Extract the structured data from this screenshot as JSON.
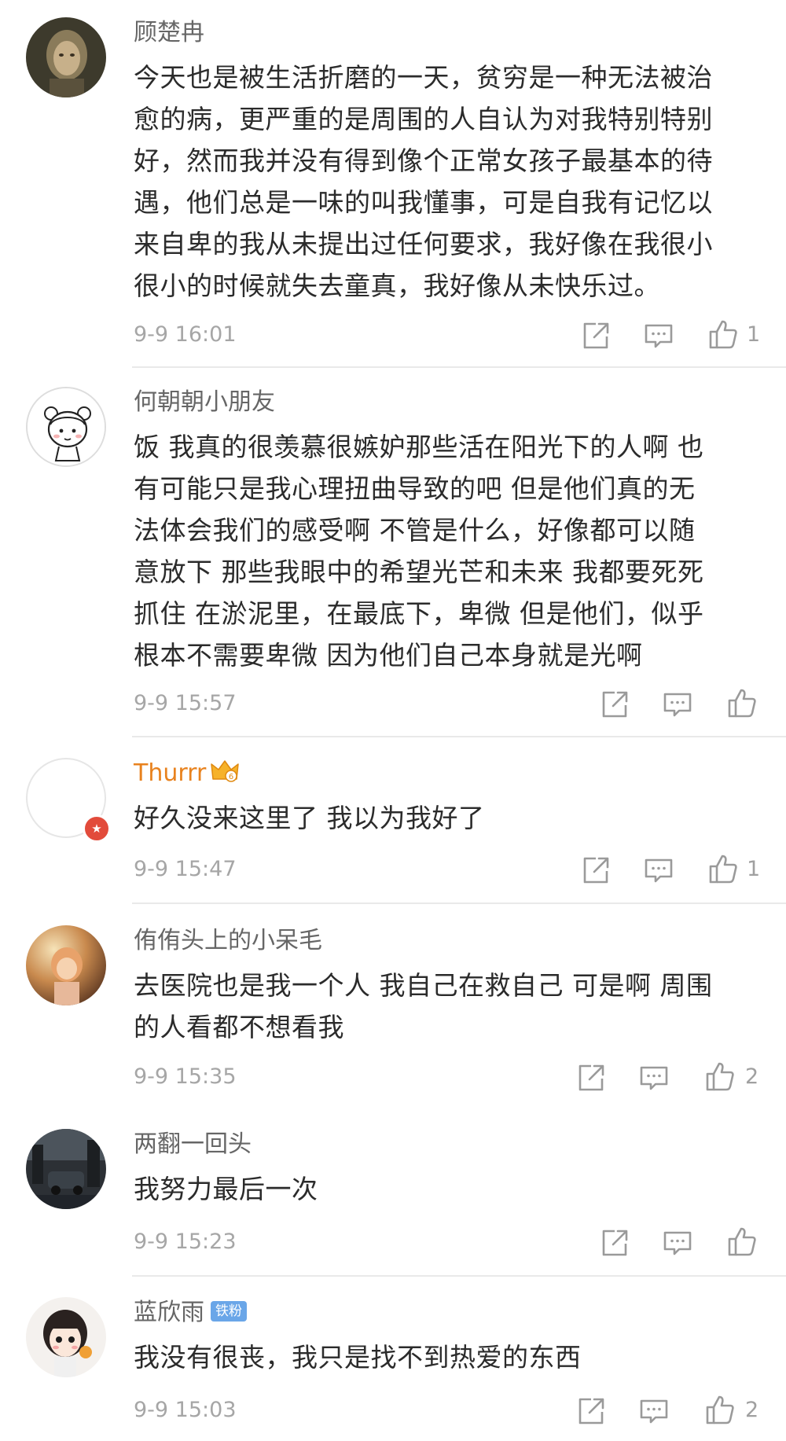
{
  "comments": [
    {
      "username": "顾楚冉",
      "lines": [
        "今天也是被生活折磨的一天，贫穷是一种无法被治",
        "愈的病，更严重的是周围的人自认为对我特别特别",
        "好，然而我并没有得到像个正常女孩子最基本的待",
        "遇，他们总是一味的叫我懂事，可是自我有记忆以",
        "来自卑的我从未提出过任何要求，我好像在我很小",
        "很小的时候就失去童真，我好像从未快乐过。"
      ],
      "time": "9-9 16:01",
      "likes": "1"
    },
    {
      "username": "何朝朝小朋友",
      "lines": [
        "饭 我真的很羡慕很嫉妒那些活在阳光下的人啊 也",
        "有可能只是我心理扭曲导致的吧 但是他们真的无",
        "法体会我们的感受啊 不管是什么，好像都可以随",
        "意放下 那些我眼中的希望光芒和未来 我都要死死",
        "抓住 在淤泥里，在最底下，卑微 但是他们，似乎",
        "根本不需要卑微 因为他们自己本身就是光啊"
      ],
      "time": "9-9 15:57",
      "likes": ""
    },
    {
      "username": "Thurrr",
      "lines": [
        "好久没来这里了 我以为我好了"
      ],
      "time": "9-9 15:47",
      "likes": "1"
    },
    {
      "username": "侑侑头上的小呆毛",
      "lines": [
        "去医院也是我一个人 我自己在救自己 可是啊 周围",
        "的人看都不想看我"
      ],
      "time": "9-9 15:35",
      "likes": "2"
    },
    {
      "username": "两翻一回头",
      "lines": [
        "我努力最后一次"
      ],
      "time": "9-9 15:23",
      "likes": ""
    },
    {
      "username": "蓝欣雨",
      "badge": "铁粉",
      "lines": [
        "我没有很丧，我只是找不到热爱的东西"
      ],
      "time": "9-9 15:03",
      "likes": "2"
    }
  ],
  "icons": {
    "repost": "repost-icon",
    "comment": "comment-icon",
    "like": "like-icon",
    "crown": "crown-icon",
    "star": "star-icon"
  },
  "colors": {
    "username": "#666666",
    "vip_username": "#e8821e",
    "text": "#2b2b2b",
    "meta": "#a6a6a6",
    "badge": "#6aa6e8",
    "divider": "#e9e9e9"
  }
}
